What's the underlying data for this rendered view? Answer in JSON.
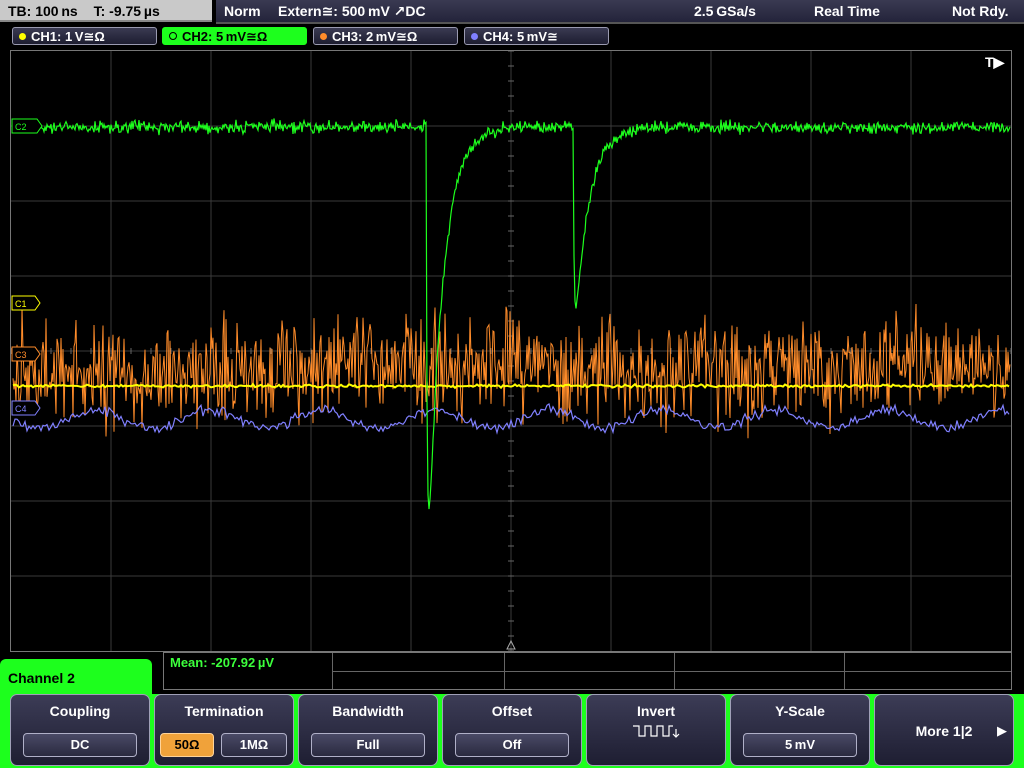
{
  "status": {
    "timebase": "TB: 100 ns",
    "trigger_time": "T: -9.75 µs",
    "mode": "Norm",
    "trigger_source": "Extern≅: 500 mV ↗DC",
    "sample_rate": "2.5 GSa/s",
    "acq_mode": "Real Time",
    "state": "Not Rdy."
  },
  "channels": [
    {
      "label": "CH1: 1 V≅Ω",
      "color": "#ffff00"
    },
    {
      "label": "CH2: 5 mV≅Ω",
      "color": "#1dff1d",
      "active": true
    },
    {
      "label": "CH3: 2 mV≅Ω",
      "color": "#ff8c2a"
    },
    {
      "label": "CH4: 5 mV≅",
      "color": "#8080ff"
    }
  ],
  "markers": {
    "trigger_indicator": "T▶",
    "c1": "C1",
    "c2": "C2",
    "c3": "C3",
    "c4": "C4"
  },
  "measurement": {
    "mean_label": "Mean: -207.92 µV"
  },
  "panel": {
    "title": "Channel 2",
    "coupling": {
      "title": "Coupling",
      "value": "DC"
    },
    "termination": {
      "title": "Termination",
      "opt1": "50Ω",
      "opt2": "1MΩ",
      "selected": "50Ω"
    },
    "bandwidth": {
      "title": "Bandwidth",
      "value": "Full"
    },
    "offset": {
      "title": "Offset",
      "value": "Off"
    },
    "invert": {
      "title": "Invert",
      "icon": "inverted-square-wave-icon"
    },
    "yscale": {
      "title": "Y-Scale",
      "value": "5 mV"
    },
    "more": {
      "label": "More 1|2"
    }
  }
}
